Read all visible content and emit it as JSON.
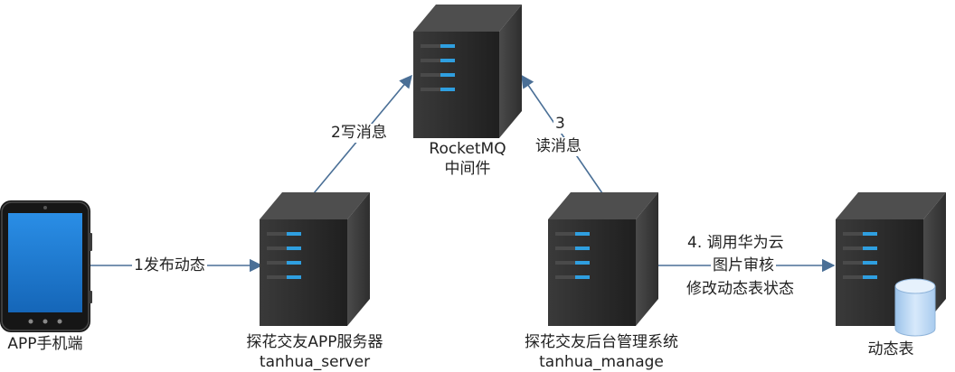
{
  "nodes": {
    "phone": {
      "label": "APP手机端",
      "icon": "smartphone-icon"
    },
    "server": {
      "label_line1": "探花交友APP服务器",
      "label_line2": "tanhua_server",
      "icon": "server-icon"
    },
    "mq": {
      "label_line1": "RocketMQ",
      "label_line2": "中间件",
      "icon": "server-icon"
    },
    "manage": {
      "label_line1": "探花交友后台管理系统",
      "label_line2": "tanhua_manage",
      "icon": "server-icon"
    },
    "table": {
      "label": "动态表",
      "icon": "database-server-icon"
    }
  },
  "edges": {
    "publish": "1发布动态",
    "write": "2写消息",
    "read_num": "3",
    "read_text": "读消息",
    "review_line1": "4. 调用华为云",
    "review_line2": "图片审核",
    "review_line3": "修改动态表状态"
  },
  "colors": {
    "arrow": "#4a6f96",
    "server_body": "#2b2b2b",
    "server_led": "#2f9fe0",
    "phone_screen": "#1e7fd6",
    "database": "#bcd8f5"
  }
}
